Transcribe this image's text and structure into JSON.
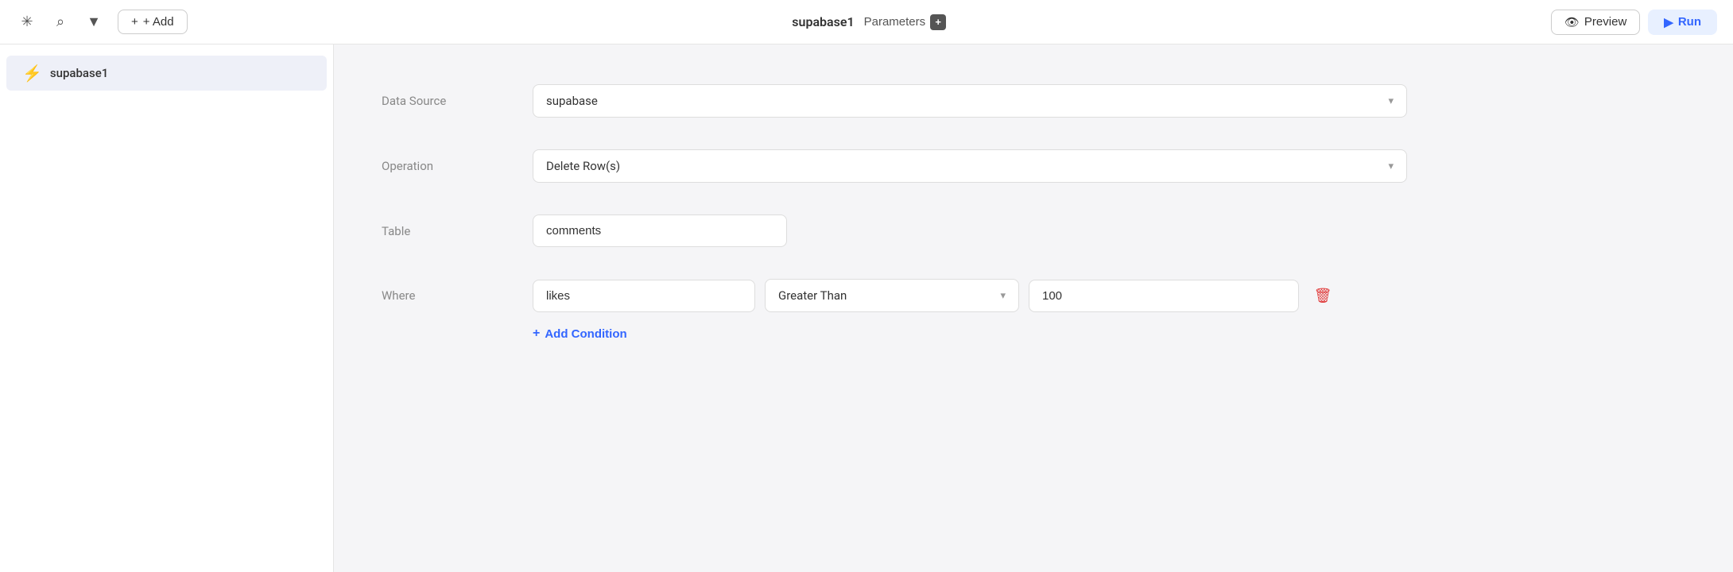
{
  "topnav": {
    "add_label": "+ Add",
    "title": "supabase1",
    "parameters_label": "Parameters",
    "preview_label": "Preview",
    "run_label": "Run"
  },
  "sidebar": {
    "items": [
      {
        "id": "supabase1",
        "label": "supabase1",
        "icon": "⚡"
      }
    ]
  },
  "form": {
    "data_source_label": "Data Source",
    "data_source_value": "supabase",
    "operation_label": "Operation",
    "operation_value": "Delete Row(s)",
    "table_label": "Table",
    "table_value": "comments",
    "where_label": "Where",
    "where_conditions": [
      {
        "field": "likes",
        "operator": "Greater Than",
        "value": "100"
      }
    ],
    "add_condition_label": "Add Condition"
  },
  "colors": {
    "accent": "#3366ff",
    "delete": "#e03c3c",
    "sidebar_active_bg": "#eef0f8",
    "icon_green": "#22c55e"
  }
}
